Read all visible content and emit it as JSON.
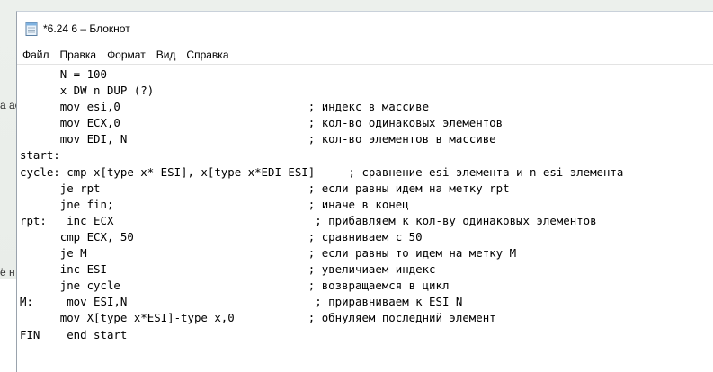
{
  "window": {
    "title": "*6.24 6 – Блокнот"
  },
  "background": {
    "left_snippets": [
      "а ас",
      "ё н"
    ]
  },
  "menu": {
    "items": [
      "Файл",
      "Правка",
      "Формат",
      "Вид",
      "Справка"
    ]
  },
  "editor": {
    "lines": [
      "      N = 100",
      "      x DW n DUP (?)",
      "      mov esi,0                            ; индекс в массиве",
      "      mov ECX,0                            ; кол-во одинаковых элементов",
      "      mov EDI, N                           ; кол-во элементов в массиве",
      "start:",
      "cycle: cmp x[type x* ESI], x[type x*EDI-ESI]     ; сравнение esi элемента и n-esi элемента",
      "      je rpt                               ; если равны идем на метку rpt",
      "      jne fin;                             ; иначе в конец",
      "rpt:   inc ECX                              ; прибавляем к кол-ву одинаковых элементов",
      "      cmp ECX, 50                          ; сравниваем с 50",
      "      je M                                 ; если равны то идем на метку M",
      "      inc ESI                              ; увеличиаем индекс",
      "      jne cycle                            ; возвращаемся в цикл",
      "M:     mov ESI,N                            ; приравниваем к ESI N",
      "      mov X[type x*ESI]-type x,0           ; обнуляем последний элемент",
      "FIN    end start"
    ]
  }
}
